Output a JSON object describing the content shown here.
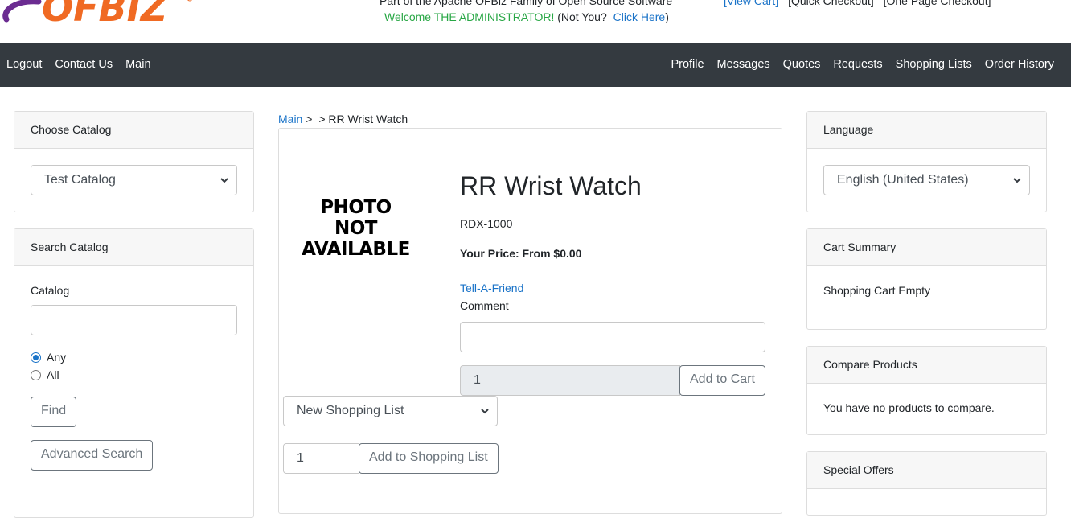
{
  "header": {
    "logo_text": "OFBIZ",
    "tagline": "Part of the Apache OFBiz Family of Open Source Software",
    "welcome": "Welcome THE ADMINISTRATOR!",
    "not_you": "(Not You?",
    "click_here": "Click Here",
    "close_paren": ")",
    "view_cart": "[View Cart]",
    "quick_checkout": "[Quick Checkout]",
    "one_page_checkout": "[One Page Checkout]"
  },
  "nav": {
    "left": [
      "Logout",
      "Contact Us",
      "Main"
    ],
    "right": [
      "Profile",
      "Messages",
      "Quotes",
      "Requests",
      "Shopping Lists",
      "Order History"
    ]
  },
  "choose_catalog": {
    "title": "Choose Catalog",
    "selected": "Test Catalog"
  },
  "search_catalog": {
    "title": "Search Catalog",
    "catalog_label": "Catalog",
    "catalog_value": "",
    "radio_any": "Any",
    "radio_all": "All",
    "find_label": "Find",
    "advanced_label": "Advanced Search"
  },
  "breadcrumb": {
    "main": "Main",
    "sep1": ">",
    "sep2": ">",
    "current": "RR Wrist Watch"
  },
  "product": {
    "photo_line1": "PHOTO",
    "photo_line2": "NOT",
    "photo_line3": "AVAILABLE",
    "name": "RR Wrist Watch",
    "sku": "RDX-1000",
    "price_label": "Your Price: From $0.00",
    "tell_a_friend": "Tell-A-Friend",
    "comment_label": "Comment",
    "comment_value": "",
    "quantity": "1",
    "add_to_cart_label": "Add to Cart",
    "shopping_list_selected": "New Shopping List",
    "list_quantity": "1",
    "add_to_list_label": "Add to Shopping List"
  },
  "language": {
    "title": "Language",
    "selected": "English (United States)"
  },
  "cart_summary": {
    "title": "Cart Summary",
    "body": "Shopping Cart Empty"
  },
  "compare": {
    "title": "Compare Products",
    "body": "You have no products to compare."
  },
  "special_offers": {
    "title": "Special Offers"
  },
  "colors": {
    "navbar": "#343a40",
    "link": "#1a73c8",
    "welcome_green": "#28a745",
    "logo_orange": "#f06a23",
    "logo_purple": "#6b2c91"
  }
}
